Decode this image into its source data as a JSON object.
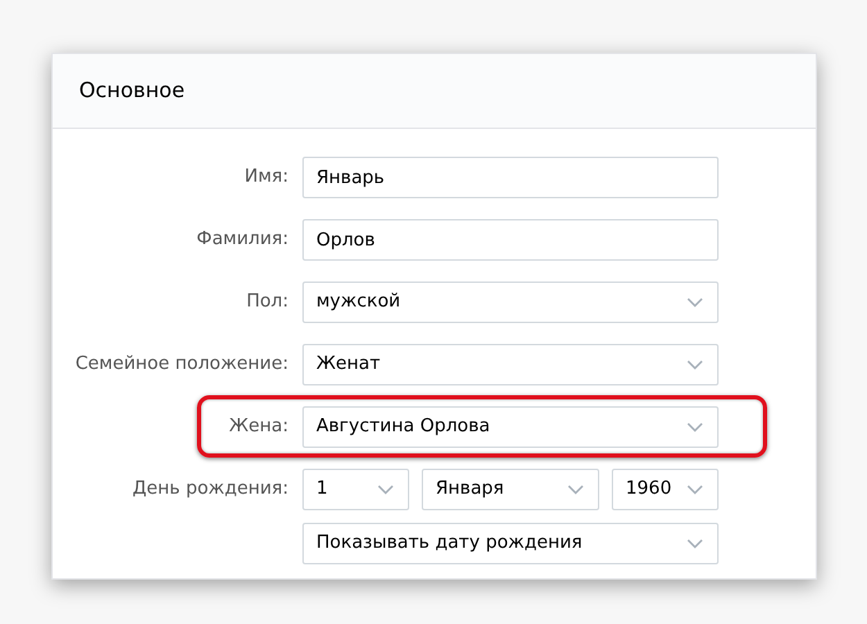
{
  "section": {
    "title": "Основное"
  },
  "fields": [
    {
      "label": "Имя:",
      "kind": "text",
      "value": "Январь",
      "highlighted": false
    },
    {
      "label": "Фамилия:",
      "kind": "text",
      "value": "Орлов",
      "highlighted": false
    },
    {
      "label": "Пол:",
      "kind": "select",
      "value": "мужской",
      "highlighted": false
    },
    {
      "label": "Семейное положение:",
      "kind": "select",
      "value": "Женат",
      "highlighted": false
    },
    {
      "label": "Жена:",
      "kind": "select",
      "value": "Августина Орлова",
      "highlighted": true
    },
    {
      "label": "День рождения:",
      "kind": "date",
      "parts": [
        "1",
        "Января",
        "1960"
      ],
      "highlighted": false
    },
    {
      "kind": "select",
      "value": "Показывать дату рождения",
      "highlighted": false
    }
  ]
}
